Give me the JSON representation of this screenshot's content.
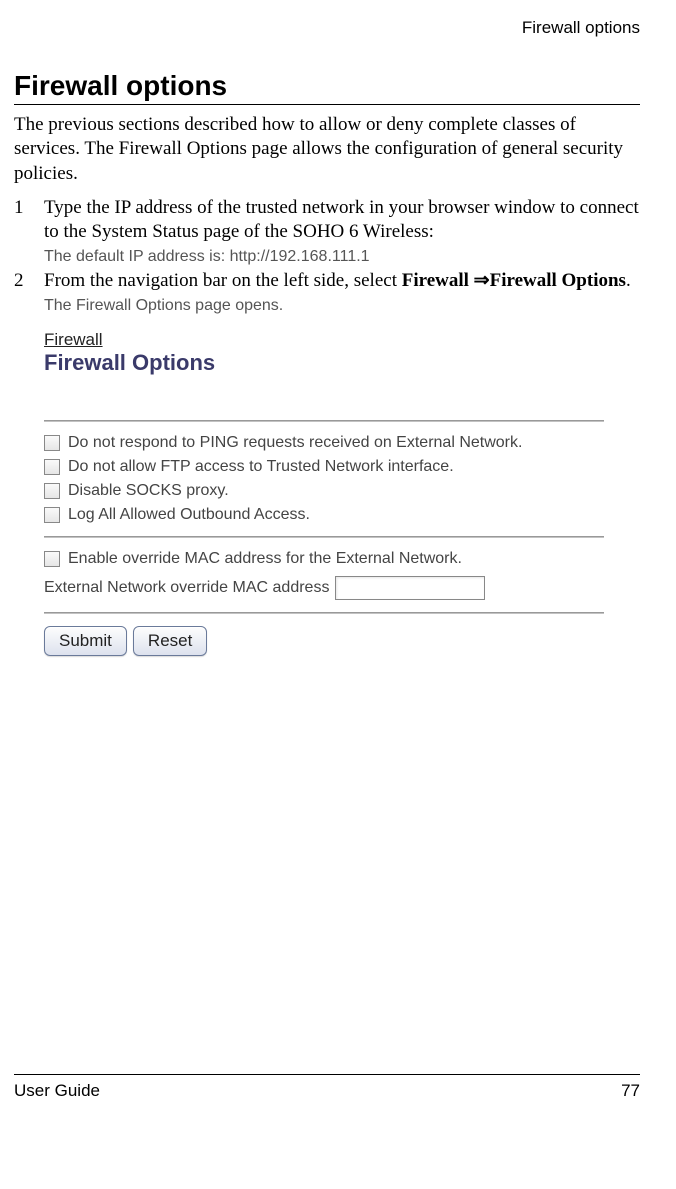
{
  "header": {
    "running": "Firewall options"
  },
  "section": {
    "title": "Firewall options",
    "intro": "The previous sections described how to allow or deny complete classes of services. The Firewall Options page allows the configuration of general security policies."
  },
  "steps": [
    {
      "num": "1",
      "text": "Type the IP address of the trusted network in your browser window to connect to the System Status page of the SOHO 6 Wireless:",
      "note": "The default IP address is: http://192.168.111.1"
    },
    {
      "num": "2",
      "text_prefix": "From the navigation bar on the left side, select ",
      "path_a": "Firewall",
      "arrow": "⇒",
      "path_b": "Firewall Options",
      "text_suffix": ".",
      "note": "The Firewall Options page opens."
    }
  ],
  "screenshot": {
    "crumb": "Firewall",
    "title": "Firewall Options",
    "options": [
      "Do not respond to PING requests received on External Network.",
      "Do not allow FTP access to Trusted Network interface.",
      "Disable SOCKS proxy.",
      "Log All Allowed Outbound Access."
    ],
    "mac": {
      "enable": "Enable override MAC address for the External Network.",
      "label": "External Network override MAC address",
      "value": ""
    },
    "buttons": {
      "submit": "Submit",
      "reset": "Reset"
    }
  },
  "footer": {
    "left": "User Guide",
    "right": "77"
  }
}
